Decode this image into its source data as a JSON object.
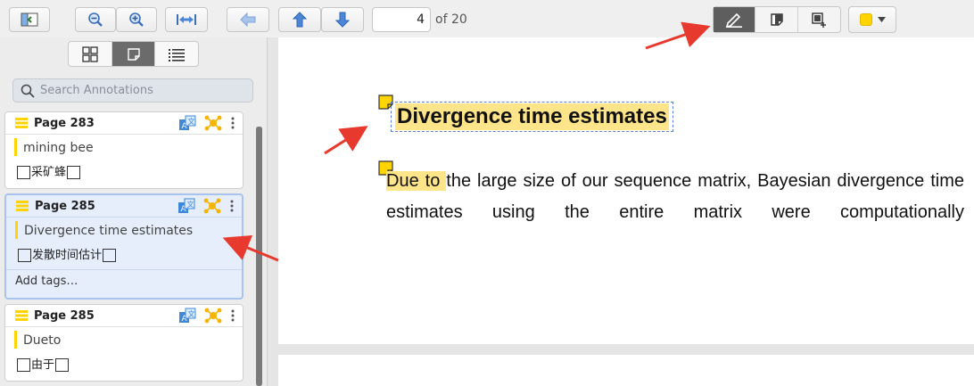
{
  "toolbar": {
    "current_page": "4",
    "page_count_label": "of 20",
    "icons": [
      "sidebar-toggle-icon",
      "zoom-out-icon",
      "zoom-in-icon",
      "fit-width-icon",
      "back-icon",
      "previous-page-icon",
      "next-page-icon"
    ],
    "annotation_tools": [
      {
        "name": "highlight-tool",
        "icon": "pen-icon",
        "active": true
      },
      {
        "name": "note-tool",
        "icon": "note-icon",
        "active": false
      },
      {
        "name": "area-tool",
        "icon": "area-icon",
        "active": false
      }
    ],
    "color": "#ffd400"
  },
  "sidebar": {
    "view_modes": [
      "thumbnails-icon",
      "annotations-icon",
      "outline-icon"
    ],
    "search": {
      "placeholder": "Search Annotations"
    },
    "cards": [
      {
        "page": "Page 283",
        "text": "mining bee",
        "comment": "采矿蜂",
        "selected": false
      },
      {
        "page": "Page 285",
        "text": "Divergence time estimates",
        "comment": "发散时间估计",
        "tags": "Add tags…",
        "selected": true
      },
      {
        "page": "Page 285",
        "text": "Dueto",
        "comment": "由于",
        "selected": false
      }
    ]
  },
  "document": {
    "heading": "Divergence time estimates",
    "paragraph_highlight": "Due to ",
    "paragraph_rest": "the large size of our sequence matrix, Bayesian divergence time estimates using the entire matrix were computationally"
  },
  "colors": {
    "highlight": "#ffe58a",
    "accent_yellow": "#ffd400",
    "arrow": "#e8392e",
    "selection_border": "#5b7fd1"
  }
}
